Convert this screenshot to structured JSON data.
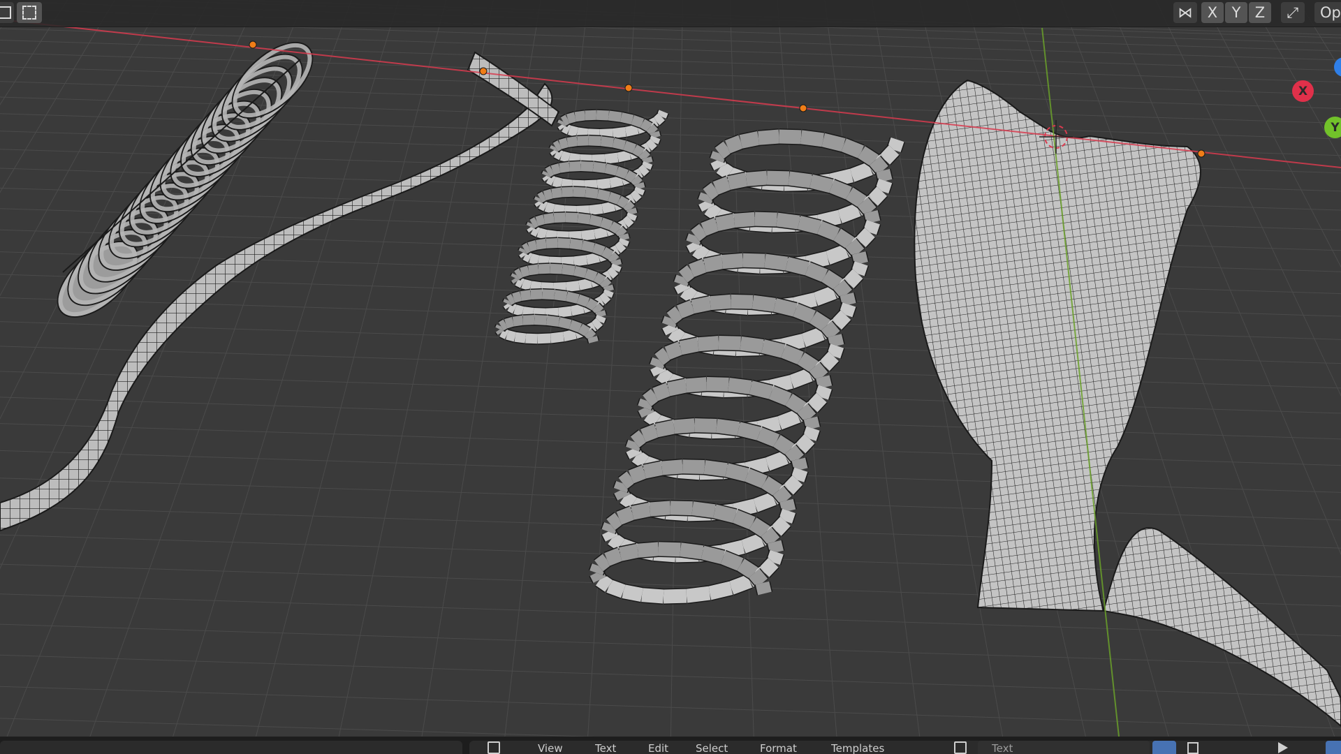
{
  "colors": {
    "viewport_bg": "#3a3a3a",
    "grid_line": "#4a4a4a",
    "x_axis": "#d83b4f",
    "y_axis": "#6aa02a",
    "mesh_fill": "#b9b9b9",
    "mesh_wire": "#1e1e1e",
    "origin_point": "#f07d17",
    "gizmo_x": "#e0304a",
    "gizmo_y": "#72c22a",
    "gizmo_z": "#2f7fe8"
  },
  "header": {
    "select_box_icon": "select-box-icon",
    "select_mode_icon": "select-mode-icon",
    "mirror_icon": "mirror-icon",
    "axis_x": "X",
    "axis_y": "Y",
    "axis_z": "Z",
    "proportional_icon": "snap-icon",
    "options_label": "Op"
  },
  "gizmo": {
    "x_label": "X",
    "y_label": "Y"
  },
  "objects": [
    {
      "name": "coil-mesh"
    },
    {
      "name": "twisted-ribbon-mesh"
    },
    {
      "name": "small-helix-mesh"
    },
    {
      "name": "large-helix-mesh"
    },
    {
      "name": "twisted-cloth-mesh"
    }
  ],
  "statusbar": {
    "left_text": "",
    "menu_view": "View",
    "menu_text": "Text",
    "menu_edit": "Edit",
    "menu_select": "Select",
    "menu_format": "Format",
    "menu_templates": "Templates",
    "text_name": "Text"
  }
}
